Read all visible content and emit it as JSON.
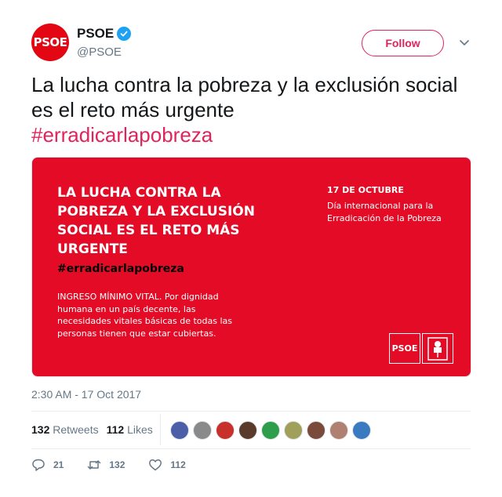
{
  "account": {
    "avatar_text": "PSOE",
    "name": "PSOE",
    "handle": "@PSOE",
    "verified": true,
    "follow_label": "Follow"
  },
  "tweet": {
    "text": "La lucha contra la pobreza y la exclusión social es el reto más urgente",
    "hashtag": "#erradicarlapobreza",
    "timestamp": "2:30 AM - 17 Oct 2017"
  },
  "media": {
    "title": "LA LUCHA CONTRA LA POBREZA Y LA EXCLUSIÓN SOCIAL ES EL RETO MÁS URGENTE",
    "hashtag": "#erradicarlapobreza",
    "body": "INGRESO MÍNIMO VITAL. Por dignidad humana en un país decente, las necesidades vitales básicas de todas las personas tienen que estar cubiertas.",
    "date": "17 DE OCTUBRE",
    "subtitle": "Día internacional para la Erradicación de la Pobreza",
    "logo_text": "PSOE",
    "background_color": "#e30b25"
  },
  "stats": {
    "retweets_count": "132",
    "retweets_label": "Retweets",
    "likes_count": "112",
    "likes_label": "Likes"
  },
  "likers": [
    {
      "color": "#4a5fa8"
    },
    {
      "color": "#8a8a8a"
    },
    {
      "color": "#c8302a"
    },
    {
      "color": "#5a3a2a"
    },
    {
      "color": "#2e9e4a"
    },
    {
      "color": "#a0a05a"
    },
    {
      "color": "#7a4a3a"
    },
    {
      "color": "#b08070"
    },
    {
      "color": "#3a7ac0"
    }
  ],
  "actions": {
    "replies": "21",
    "retweets": "132",
    "likes": "112"
  },
  "colors": {
    "accent": "#e0245e",
    "verified": "#1da1f2",
    "brand_red": "#e30613"
  }
}
